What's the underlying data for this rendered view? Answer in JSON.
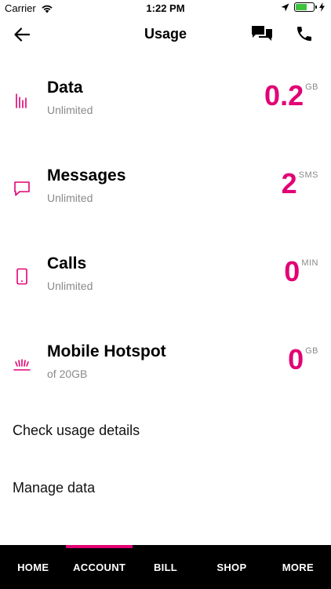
{
  "status_bar": {
    "carrier": "Carrier",
    "time": "1:22 PM"
  },
  "header": {
    "title": "Usage"
  },
  "usage": [
    {
      "name": "Data",
      "sub": "Unlimited",
      "value": "0.2",
      "unit": "GB",
      "icon": "bar-chart-icon"
    },
    {
      "name": "Messages",
      "sub": "Unlimited",
      "value": "2",
      "unit": "SMS",
      "icon": "message-icon"
    },
    {
      "name": "Calls",
      "sub": "Unlimited",
      "value": "0",
      "unit": "MIN",
      "icon": "phone-device-icon"
    },
    {
      "name": "Mobile Hotspot",
      "sub": "of 20GB",
      "value": "0",
      "unit": "GB",
      "icon": "hotspot-icon"
    }
  ],
  "links": {
    "check_usage": "Check usage details",
    "manage_data": "Manage data"
  },
  "nav": [
    {
      "label": "HOME"
    },
    {
      "label": "ACCOUNT",
      "active": true
    },
    {
      "label": "BILL"
    },
    {
      "label": "SHOP"
    },
    {
      "label": "MORE"
    }
  ],
  "colors": {
    "accent": "#e20074",
    "nav_bg": "#000000",
    "battery": "#3cc23c"
  }
}
